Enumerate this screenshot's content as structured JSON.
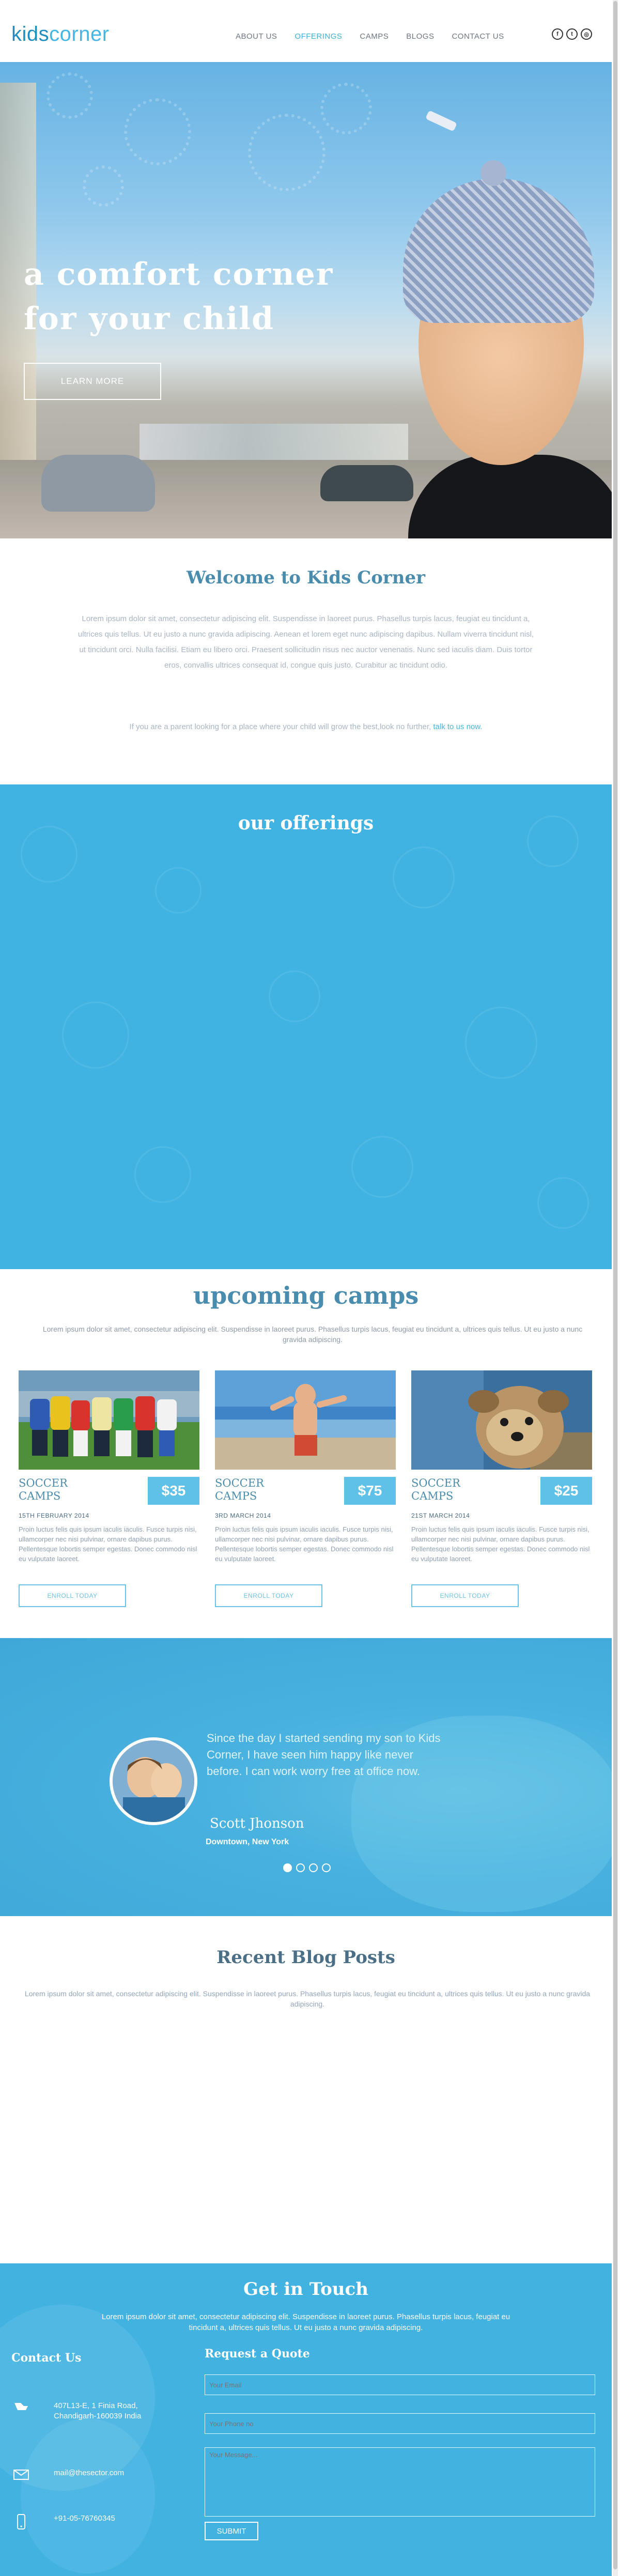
{
  "header": {
    "logo_kids": "kids",
    "logo_corner": "corner",
    "nav": [
      "ABOUT US",
      "OFFERINGS",
      "CAMPS",
      "BLOGS",
      "CONTACT US"
    ],
    "active_nav": "OFFERINGS",
    "socials": [
      {
        "icon": "facebook-icon",
        "glyph": "f"
      },
      {
        "icon": "twitter-icon",
        "glyph": "t"
      },
      {
        "icon": "instagram-icon",
        "glyph": "◎"
      }
    ]
  },
  "hero": {
    "title_line1": "a comfort corner",
    "title_line2": "for your child",
    "button": "LEARN MORE"
  },
  "welcome": {
    "title": "Welcome to Kids Corner",
    "text": "Lorem ipsum dolor sit amet, consectetur adipiscing elit. Suspendisse in laoreet purus. Phasellus turpis lacus, feugiat eu tincidunt a, ultrices quis tellus. Ut eu justo a nunc gravida adipiscing. Aenean et lorem eget nunc adipiscing dapibus. Nullam viverra tincidunt nisl, ut tincidunt orci. Nulla facilisi. Etiam eu libero orci. Praesent sollicitudin risus nec auctor venenatis. Nunc sed iaculis diam. Duis tortor eros, convallis ultrices consequat id, congue quis justo. Curabitur ac tincidunt odio.",
    "cta_text": "If you are a parent looking for a place where your child will grow the best,look no further,",
    "cta_link": "talk to us now."
  },
  "offerings": {
    "title": "our offerings"
  },
  "camps": {
    "title": "upcoming camps",
    "subtitle": "Lorem ipsum dolor sit amet, consectetur adipiscing elit. Suspendisse in laoreet purus. Phasellus turpis lacus, feugiat eu tincidunt a, ultrices quis tellus. Ut eu justo a nunc gravida adipiscing.",
    "items": [
      {
        "name": "SOCCER CAMPS",
        "price": "$35",
        "date": "15TH FEBRUARY 2014",
        "desc": "Proin luctus felis quis ipsum iaculis iaculis. Fusce turpis nisi, ullamcorper nec nisi pulvinar, ornare dapibus purus. Pellentesque lobortis semper egestas. Donec commodo nisl eu vulputate laoreet.",
        "button": "ENROLL TODAY"
      },
      {
        "name": "SOCCER CAMPS",
        "price": "$75",
        "date": "3RD MARCH 2014",
        "desc": "Proin luctus felis quis ipsum iaculis iaculis. Fusce turpis nisi, ullamcorper nec nisi pulvinar, ornare dapibus purus. Pellentesque lobortis semper egestas. Donec commodo nisl eu vulputate laoreet.",
        "button": "ENROLL TODAY"
      },
      {
        "name": "SOCCER CAMPS",
        "price": "$25",
        "date": "21ST MARCH 2014",
        "desc": "Proin luctus felis quis ipsum iaculis iaculis. Fusce turpis nisi, ullamcorper nec nisi pulvinar, ornare dapibus purus. Pellentesque lobortis semper egestas. Donec commodo nisl eu vulputate laoreet.",
        "button": "ENROLL TODAY"
      }
    ]
  },
  "testimonial": {
    "quote": "Since the day I started sending my son to Kids Corner, I have seen him happy like never before. I can work worry free at office now.",
    "author": "Scott Jhonson",
    "location": "Downtown, New York",
    "slides": 4,
    "active_slide": 1
  },
  "blog": {
    "title": "Recent Blog Posts",
    "subtitle": "Lorem ipsum dolor sit amet, consectetur adipiscing elit. Suspendisse in laoreet purus. Phasellus turpis lacus, feugiat eu tincidunt a, ultrices quis tellus. Ut eu justo a nunc gravida adipiscing."
  },
  "contact": {
    "title": "Get in Touch",
    "subtitle": "Lorem ipsum dolor sit amet, consectetur adipiscing elit. Suspendisse in laoreet purus. Phasellus turpis lacus, feugiat eu tincidunt a, ultrices quis tellus. Ut eu justo a nunc gravida adipiscing.",
    "contact_us": "Contact Us",
    "address": "407L13-E, 1 Finia Road, Chandigarh-160039 India",
    "email": "mail@thesector.com",
    "phone": "+91-05-76760345",
    "request_title": "Request a Quote",
    "email_placeholder": "Your Email",
    "phone_placeholder": "Your Phone no",
    "message_placeholder": "Your Message...",
    "submit": "SUBMIT"
  },
  "colors": {
    "brand_blue": "#41b3e3",
    "heading_blue": "#4a8cad",
    "price_blue": "#5fc0e8"
  }
}
